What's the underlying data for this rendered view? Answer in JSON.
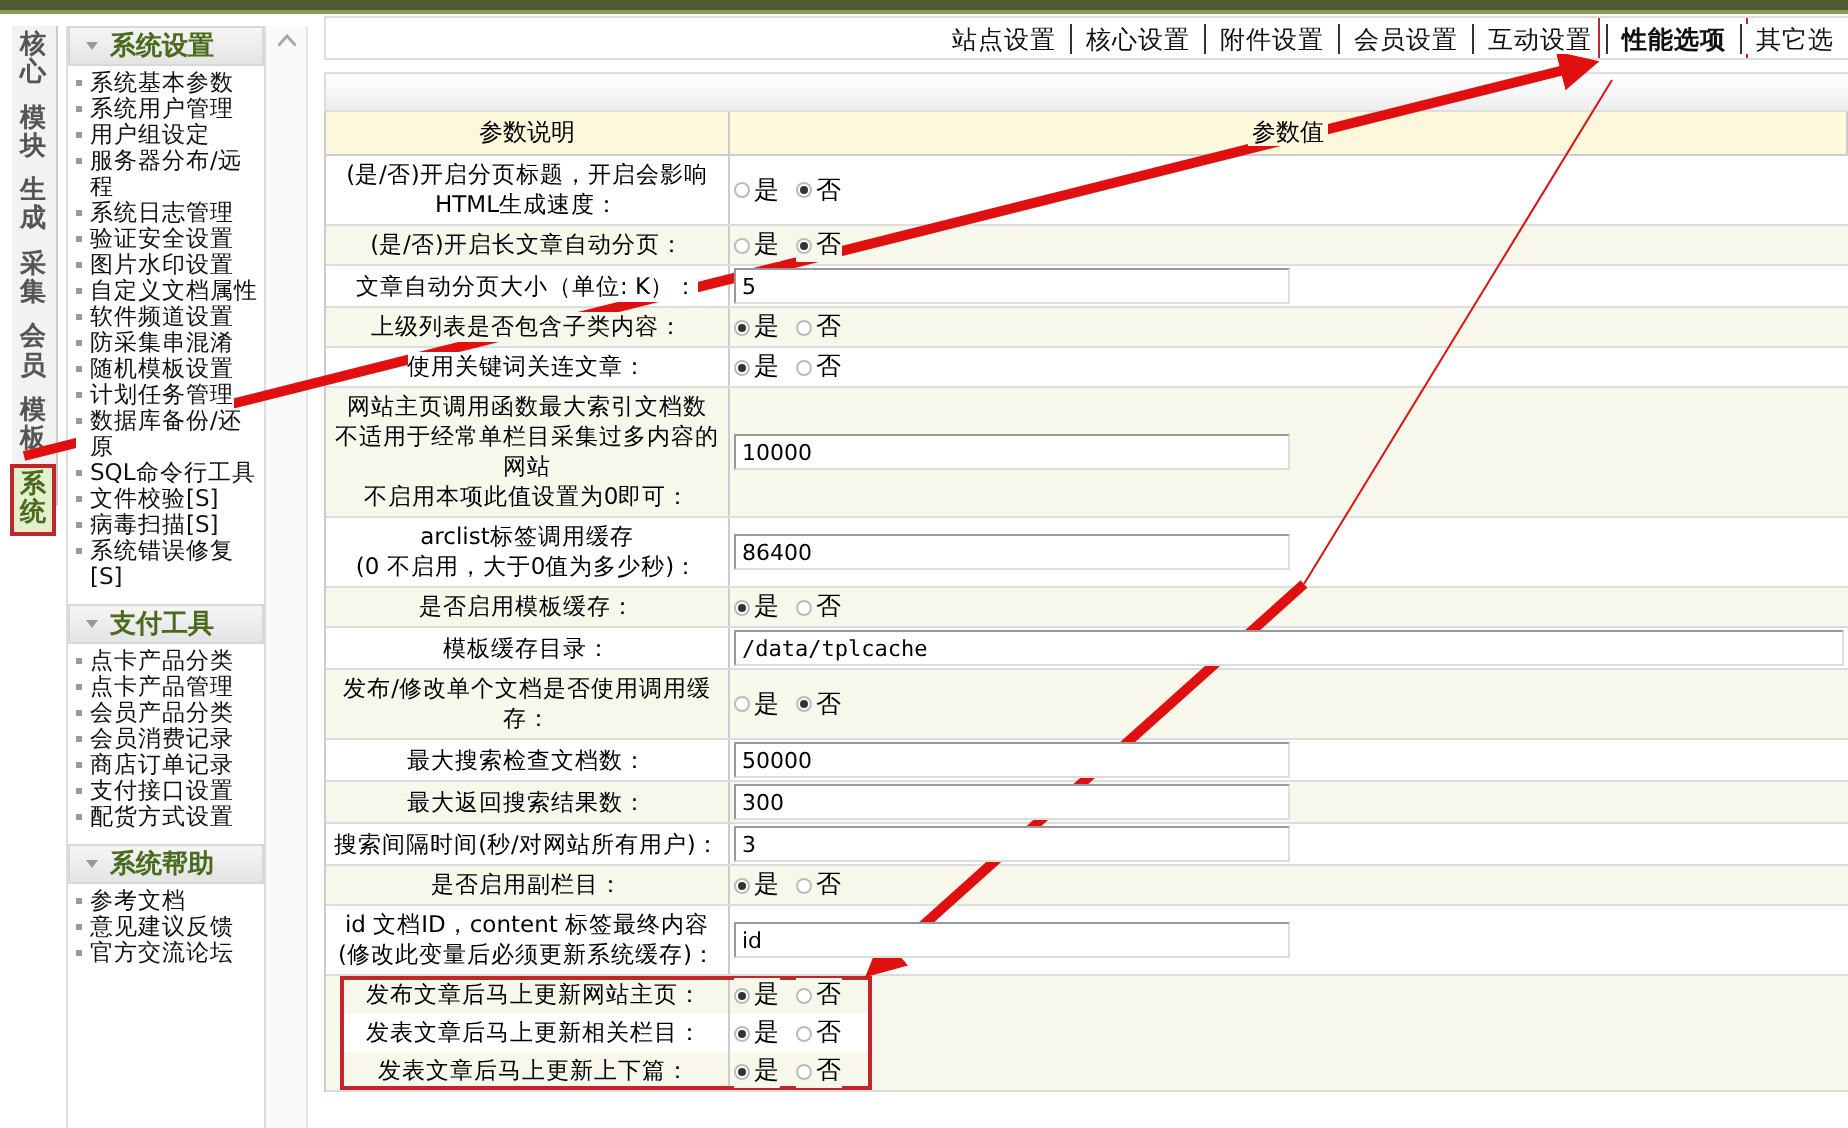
{
  "module_tabs": [
    {
      "label": "核心",
      "selected": false,
      "highlighted": false
    },
    {
      "label": "模块",
      "selected": false,
      "highlighted": false
    },
    {
      "label": "生成",
      "selected": false,
      "highlighted": false
    },
    {
      "label": "采集",
      "selected": false,
      "highlighted": false
    },
    {
      "label": "会员",
      "selected": false,
      "highlighted": false
    },
    {
      "label": "模板",
      "selected": false,
      "highlighted": false
    },
    {
      "label": "系统",
      "selected": true,
      "highlighted": true
    }
  ],
  "menu_groups": [
    {
      "title": "系统设置",
      "items": [
        "系统基本参数",
        "系统用户管理",
        "用户组设定",
        "服务器分布/远程",
        "系统日志管理",
        "验证安全设置",
        "图片水印设置",
        "自定义文档属性",
        "软件频道设置",
        "防采集串混淆",
        "随机模板设置",
        "计划任务管理",
        "数据库备份/还原",
        "SQL命令行工具",
        "文件校验[S]",
        "病毒扫描[S]",
        "系统错误修复[S]"
      ]
    },
    {
      "title": "支付工具",
      "items": [
        "点卡产品分类",
        "点卡产品管理",
        "会员产品分类",
        "会员消费记录",
        "商店订单记录",
        "支付接口设置",
        "配货方式设置"
      ]
    },
    {
      "title": "系统帮助",
      "items": [
        "参考文档",
        "意见建议反馈",
        "官方交流论坛"
      ]
    }
  ],
  "settings_tabs": [
    {
      "label": "站点设置",
      "selected": false,
      "highlighted": false
    },
    {
      "label": "核心设置",
      "selected": false,
      "highlighted": false
    },
    {
      "label": "附件设置",
      "selected": false,
      "highlighted": false
    },
    {
      "label": "会员设置",
      "selected": false,
      "highlighted": false
    },
    {
      "label": "互动设置",
      "selected": false,
      "highlighted": false
    },
    {
      "label": "性能选项",
      "selected": true,
      "highlighted": true
    },
    {
      "label": "其它选",
      "selected": false,
      "highlighted": false
    }
  ],
  "table": {
    "columns": [
      "参数说明",
      "参数值"
    ],
    "rows": [
      {
        "label": "(是/否)开启分页标题，开启会影响HTML生成速度：",
        "kind": "radio",
        "highlighted": false,
        "options": [
          {
            "label": "是",
            "selected": false
          },
          {
            "label": "否",
            "selected": true
          }
        ]
      },
      {
        "label": "(是/否)开启长文章自动分页：",
        "kind": "radio",
        "highlighted": false,
        "options": [
          {
            "label": "是",
            "selected": false
          },
          {
            "label": "否",
            "selected": true
          }
        ]
      },
      {
        "label": "文章自动分页大小（单位: K）：",
        "kind": "input",
        "highlighted": false,
        "value": "5"
      },
      {
        "label": "上级列表是否包含子类内容：",
        "kind": "radio",
        "highlighted": false,
        "options": [
          {
            "label": "是",
            "selected": true
          },
          {
            "label": "否",
            "selected": false
          }
        ]
      },
      {
        "label": "使用关键词关连文章：",
        "kind": "radio",
        "highlighted": false,
        "options": [
          {
            "label": "是",
            "selected": true
          },
          {
            "label": "否",
            "selected": false
          }
        ]
      },
      {
        "lines": [
          "网站主页调用函数最大索引文档数",
          "不适用于经常单栏目采集过多内容的网站",
          "不启用本项此值设置为0即可："
        ],
        "kind": "input",
        "highlighted": false,
        "value": "10000"
      },
      {
        "lines": [
          "arclist标签调用缓存",
          "(0 不启用，大于0值为多少秒)："
        ],
        "kind": "input",
        "highlighted": false,
        "value": "86400"
      },
      {
        "label": "是否启用模板缓存：",
        "kind": "radio",
        "highlighted": false,
        "options": [
          {
            "label": "是",
            "selected": true
          },
          {
            "label": "否",
            "selected": false
          }
        ]
      },
      {
        "label": "模板缓存目录：",
        "kind": "wide_input",
        "highlighted": false,
        "value": "/data/tplcache"
      },
      {
        "label": "发布/修改单个文档是否使用调用缓存：",
        "kind": "radio",
        "highlighted": false,
        "options": [
          {
            "label": "是",
            "selected": false
          },
          {
            "label": "否",
            "selected": true
          }
        ]
      },
      {
        "label": "最大搜索检查文档数：",
        "kind": "input",
        "highlighted": false,
        "value": "50000"
      },
      {
        "label": "最大返回搜索结果数：",
        "kind": "input",
        "highlighted": false,
        "value": "300"
      },
      {
        "label": "搜索间隔时间(秒/对网站所有用户)：",
        "kind": "input",
        "highlighted": false,
        "value": "3"
      },
      {
        "label": "是否启用副栏目：",
        "kind": "radio",
        "highlighted": false,
        "options": [
          {
            "label": "是",
            "selected": true
          },
          {
            "label": "否",
            "selected": false
          }
        ]
      },
      {
        "lines": [
          "id 文档ID，content 标签最终内容",
          "(修改此变量后必须更新系统缓存)："
        ],
        "kind": "input",
        "highlighted": false,
        "value": "id"
      },
      {
        "label": "发布文章后马上更新网站主页：",
        "kind": "radio",
        "highlighted": true,
        "options": [
          {
            "label": "是",
            "selected": true
          },
          {
            "label": "否",
            "selected": false
          }
        ]
      },
      {
        "label": "发表文章后马上更新相关栏目：",
        "kind": "radio",
        "highlighted": true,
        "options": [
          {
            "label": "是",
            "selected": true
          },
          {
            "label": "否",
            "selected": false
          }
        ]
      },
      {
        "label": "发表文章后马上更新上下篇：",
        "kind": "radio",
        "highlighted": true,
        "options": [
          {
            "label": "是",
            "selected": true
          },
          {
            "label": "否",
            "selected": false
          }
        ]
      }
    ]
  }
}
